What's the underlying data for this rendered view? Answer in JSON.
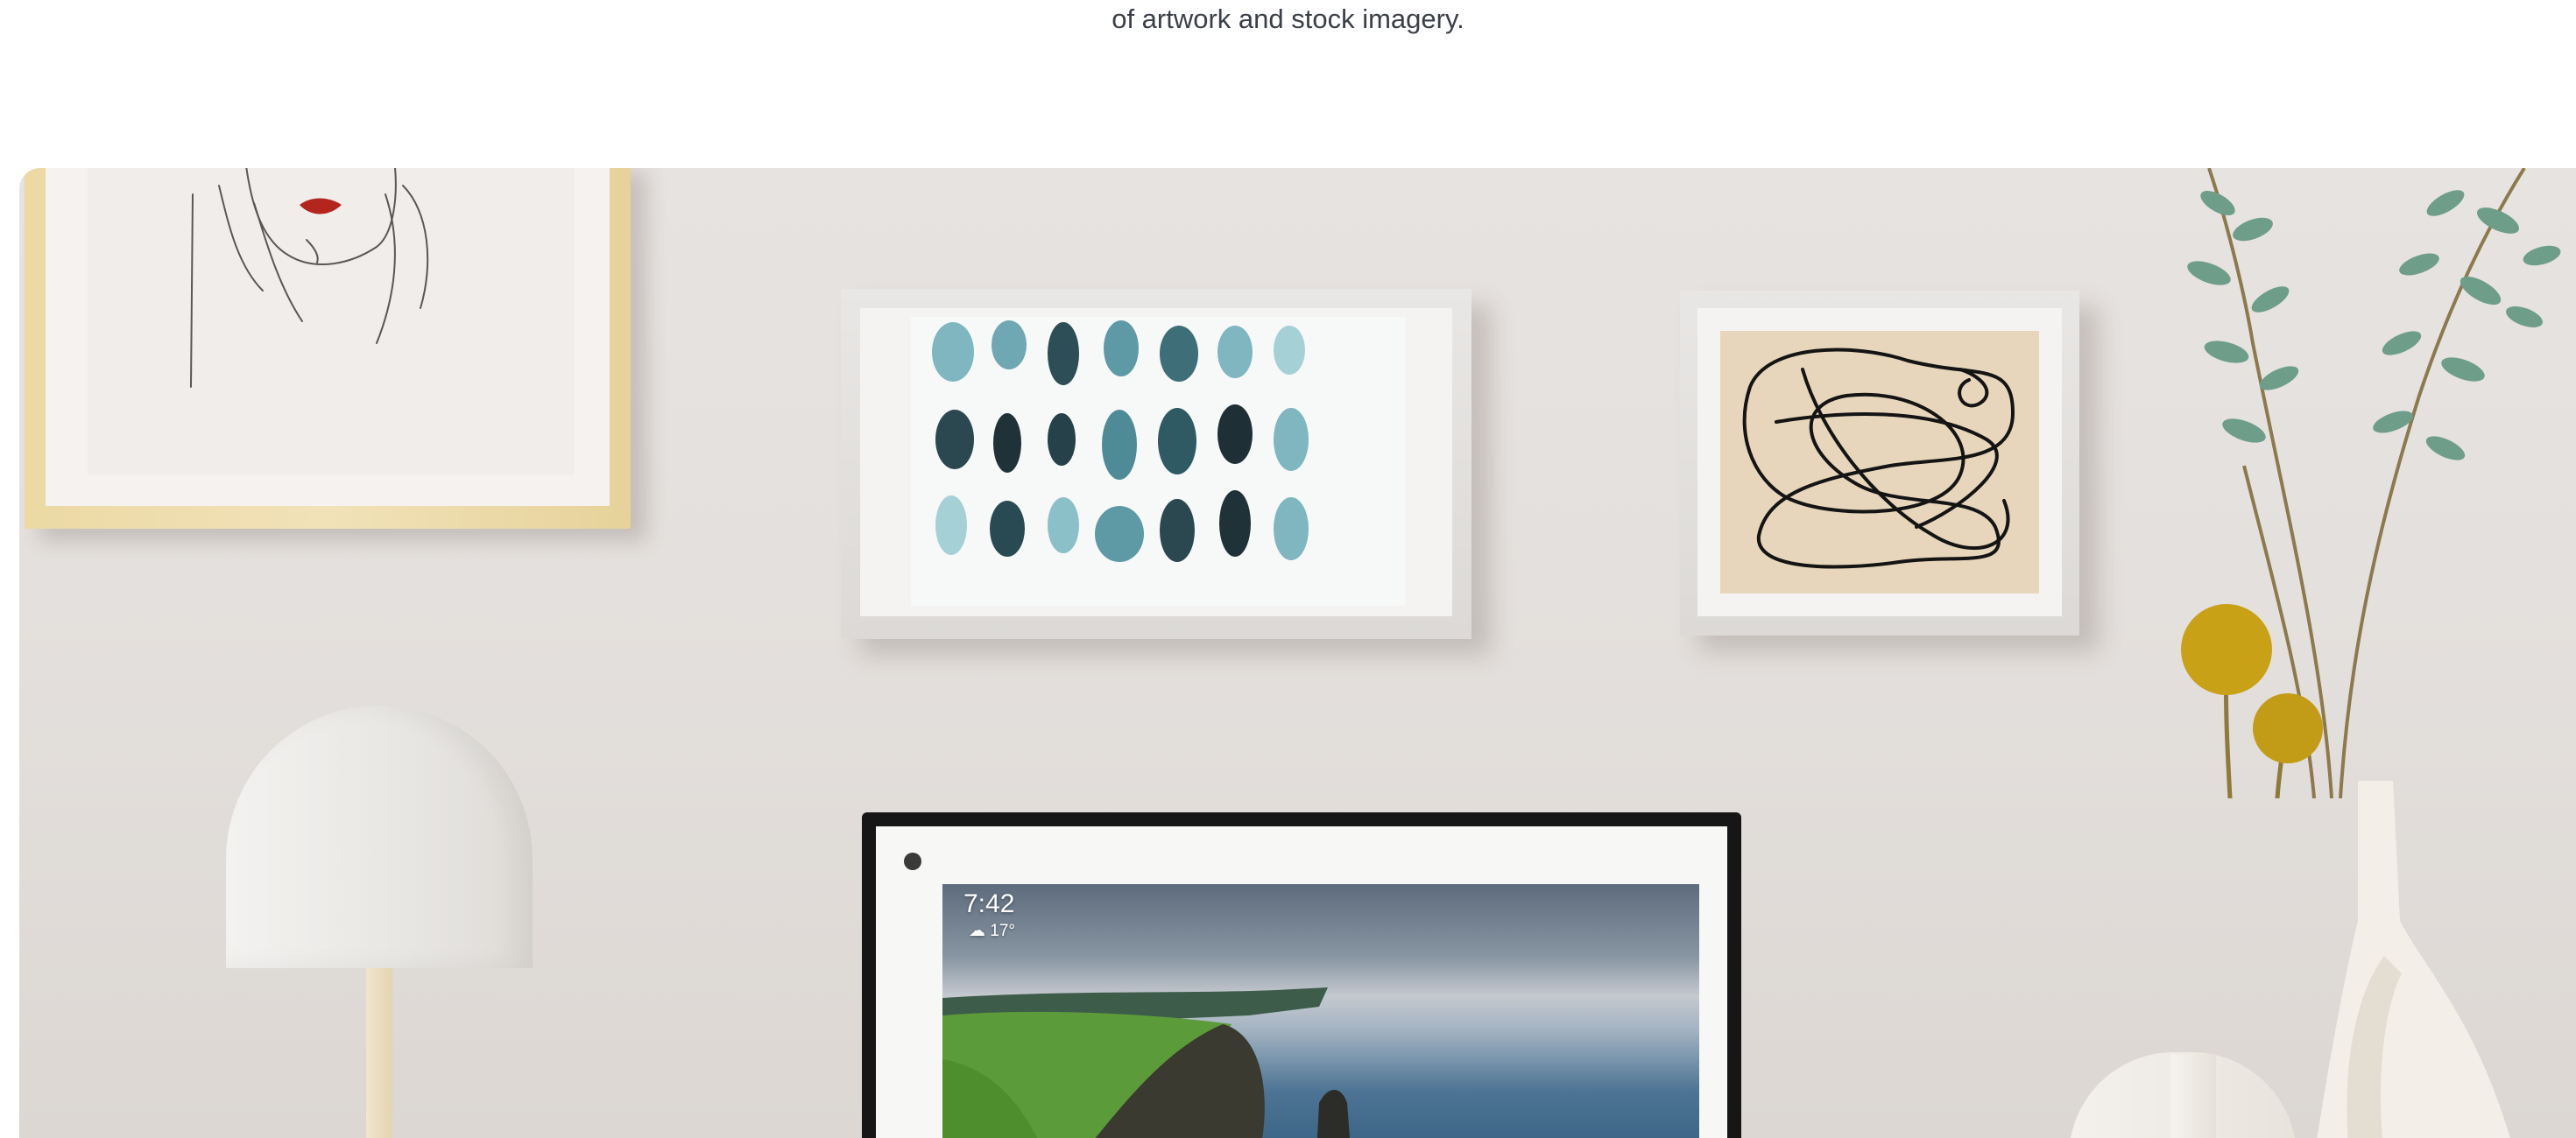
{
  "page": {
    "caption": "of artwork and stock imagery."
  },
  "device": {
    "time": "7:42",
    "weather": "☁ 17°"
  }
}
